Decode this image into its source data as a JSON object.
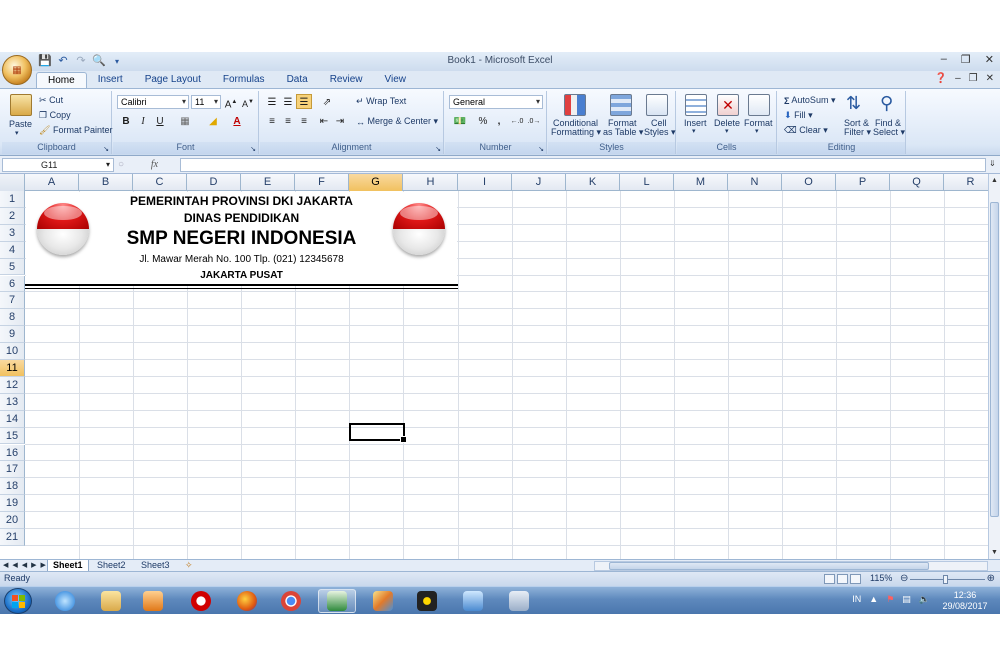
{
  "window": {
    "title": "Book1 - Microsoft Excel",
    "office_button_label": "Office"
  },
  "ribbon_tabs": [
    {
      "label": "Home",
      "active": true
    },
    {
      "label": "Insert"
    },
    {
      "label": "Page Layout"
    },
    {
      "label": "Formulas"
    },
    {
      "label": "Data"
    },
    {
      "label": "Review"
    },
    {
      "label": "View"
    }
  ],
  "clipboard": {
    "group": "Clipboard",
    "paste": "Paste",
    "cut": "Cut",
    "copy": "Copy",
    "format_painter": "Format Painter"
  },
  "font": {
    "group": "Font",
    "name": "Calibri",
    "size": "11",
    "bold": "B",
    "italic": "I",
    "underline": "U"
  },
  "alignment": {
    "group": "Alignment",
    "wrap_text": "Wrap Text",
    "merge_center": "Merge & Center"
  },
  "number": {
    "group": "Number",
    "format": "General",
    "percent": "%",
    "comma": ","
  },
  "styles": {
    "group": "Styles",
    "conditional": "Conditional",
    "formatting": "Formatting",
    "format": "Format",
    "as_table": "as Table",
    "cell": "Cell",
    "cell_styles": "Styles"
  },
  "cells": {
    "group": "Cells",
    "insert": "Insert",
    "delete": "Delete",
    "format": "Format"
  },
  "editing": {
    "group": "Editing",
    "autosum": "AutoSum",
    "fill": "Fill",
    "clear": "Clear",
    "sort": "Sort &",
    "filter": "Filter",
    "find": "Find &",
    "select": "Select"
  },
  "formula_bar": {
    "name_box": "G11",
    "fx": "fx",
    "value": ""
  },
  "columns": [
    "A",
    "B",
    "C",
    "D",
    "E",
    "F",
    "G",
    "H",
    "I",
    "J",
    "K",
    "L",
    "M",
    "N",
    "O",
    "P",
    "Q",
    "R"
  ],
  "rows": [
    "1",
    "2",
    "3",
    "4",
    "5",
    "6",
    "7",
    "8",
    "9",
    "10",
    "11",
    "12",
    "13",
    "14",
    "15",
    "16",
    "17",
    "18",
    "19",
    "20",
    "21"
  ],
  "selected_cell": {
    "column": "G",
    "row": "11"
  },
  "letterhead": {
    "line1": "PEMERINTAH PROVINSI DKI JAKARTA",
    "line2": "DINAS PENDIDIKAN",
    "line3": "SMP NEGERI INDONESIA",
    "line4": "Jl. Mawar Merah No. 100 Tlp. (021) 12345678",
    "line5": "JAKARTA PUSAT"
  },
  "sheets": [
    {
      "label": "Sheet1",
      "active": true
    },
    {
      "label": "Sheet2"
    },
    {
      "label": "Sheet3"
    }
  ],
  "status": {
    "ready": "Ready",
    "zoom": "115%",
    "zoom_fraction": 0.5
  },
  "taskbar": {
    "tray_lang": "IN",
    "time": "12:36",
    "date": "29/08/2017"
  },
  "colors": {
    "accent": "#15428b",
    "selection_header": "#f1c15f",
    "flag_red": "#e01818",
    "flag_white": "#ffffff"
  }
}
